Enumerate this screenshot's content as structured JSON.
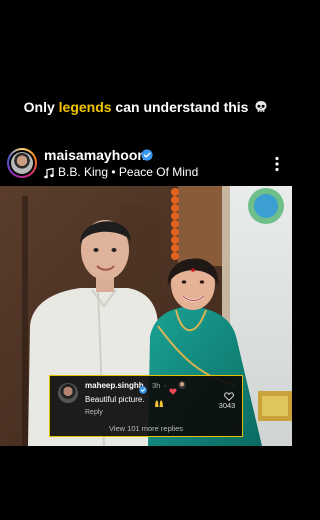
{
  "caption": {
    "prefix": "Only ",
    "highlight": "legends",
    "suffix": " can understand this",
    "emoji_icon": "skull-icon",
    "accent_color": "#f5c400"
  },
  "post": {
    "username": "maisamayhoon",
    "verified": true,
    "music": "B.B. King • Peace Of Mind",
    "more_icon": "more-vertical-icon"
  },
  "comment": {
    "username": "maheep.singhh",
    "verified": true,
    "time": "3h",
    "separator": "·",
    "text": "Beautiful picture.",
    "emoji_icon": "raising-hands-icon",
    "reply_label": "Reply",
    "likes": "3043",
    "view_more": "View 101 more replies",
    "border_color": "#e0c200"
  },
  "colors": {
    "verified_blue": "#3897f0",
    "heart_red": "#ed4956"
  }
}
